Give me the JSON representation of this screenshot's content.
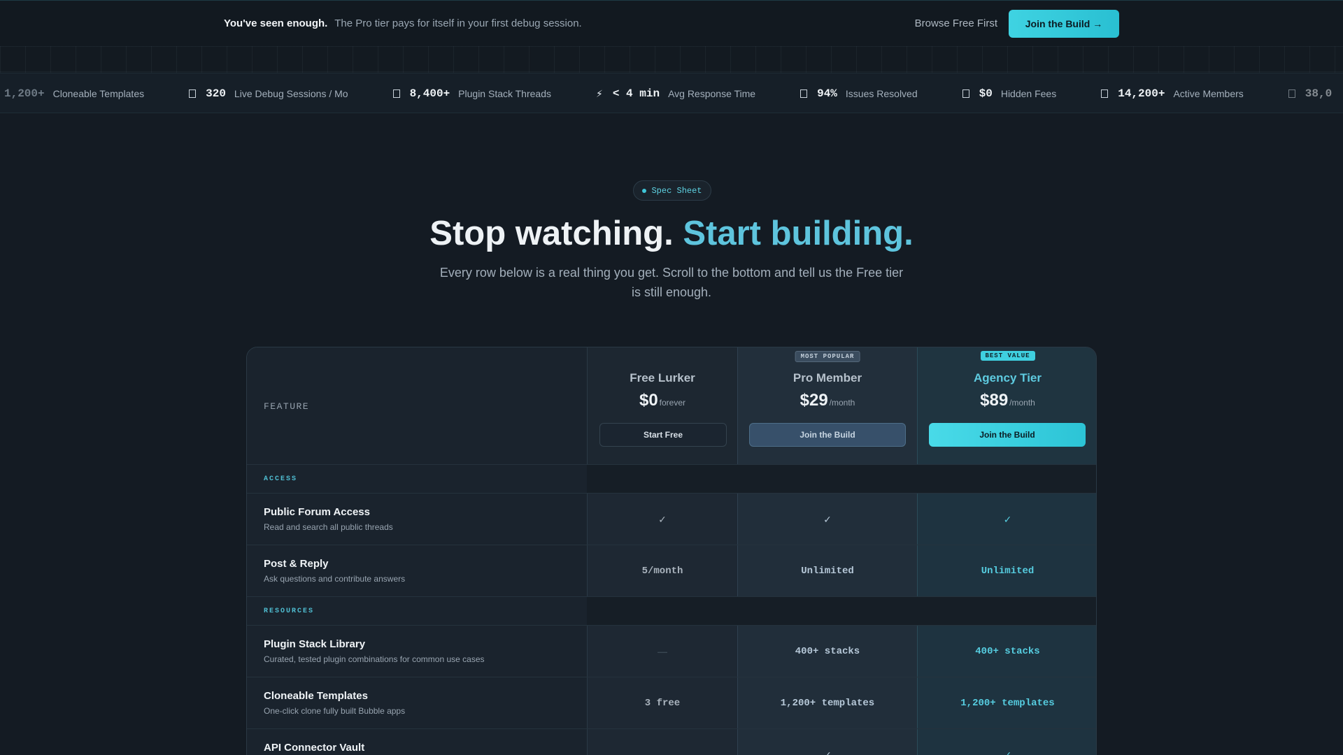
{
  "banner": {
    "bold": "You've seen enough.",
    "sub": "The Pro tier pays for itself in your first debug session.",
    "browse_label": "Browse Free First",
    "join_label": "Join the Build →"
  },
  "stats": [
    {
      "icon": "square-icon",
      "value": "1,200+",
      "label": "Cloneable Templates"
    },
    {
      "icon": "square-icon",
      "value": "320",
      "label": "Live Debug Sessions / Mo"
    },
    {
      "icon": "square-icon",
      "value": "8,400+",
      "label": "Plugin Stack Threads"
    },
    {
      "icon": "bolt-icon",
      "value": "< 4 min",
      "label": "Avg Response Time"
    },
    {
      "icon": "square-icon",
      "value": "94%",
      "label": "Issues Resolved"
    },
    {
      "icon": "square-icon",
      "value": "$0",
      "label": "Hidden Fees"
    },
    {
      "icon": "square-icon",
      "value": "14,200+",
      "label": "Active Members"
    },
    {
      "icon": "square-icon",
      "value": "38,0",
      "label": ""
    }
  ],
  "hero": {
    "pill": "Spec Sheet",
    "title_main": "Stop watching.",
    "title_accent": "Start building.",
    "subtitle": "Every row below is a real thing you get. Scroll to the bottom and tell us the Free tier is still enough."
  },
  "table": {
    "feature_header": "FEATURE",
    "tiers": [
      {
        "name": "Free Lurker",
        "price": "$0",
        "period": "forever",
        "cta": "Start Free",
        "badge": ""
      },
      {
        "name": "Pro Member",
        "price": "$29",
        "period": "/month",
        "cta": "Join the Build",
        "badge": "MOST POPULAR"
      },
      {
        "name": "Agency Tier",
        "price": "$89",
        "period": "/month",
        "cta": "Join the Build",
        "badge": "BEST VALUE"
      }
    ],
    "sections": [
      {
        "label": "ACCESS",
        "rows": [
          {
            "name": "Public Forum Access",
            "desc": "Read and search all public threads",
            "free": "✓",
            "pro": "✓",
            "agency": "✓"
          },
          {
            "name": "Post & Reply",
            "desc": "Ask questions and contribute answers",
            "free": "5/month",
            "pro": "Unlimited",
            "agency": "Unlimited"
          }
        ]
      },
      {
        "label": "RESOURCES",
        "rows": [
          {
            "name": "Plugin Stack Library",
            "desc": "Curated, tested plugin combinations for common use cases",
            "free": "—",
            "pro": "400+ stacks",
            "agency": "400+ stacks"
          },
          {
            "name": "Cloneable Templates",
            "desc": "One-click clone fully built Bubble apps",
            "free": "3 free",
            "pro": "1,200+ templates",
            "agency": "1,200+ templates"
          },
          {
            "name": "API Connector Vault",
            "desc": "",
            "free": "",
            "pro": "✓",
            "agency": "✓"
          }
        ]
      }
    ]
  },
  "colors": {
    "accent": "#3fd3e2",
    "background": "#141b23"
  }
}
